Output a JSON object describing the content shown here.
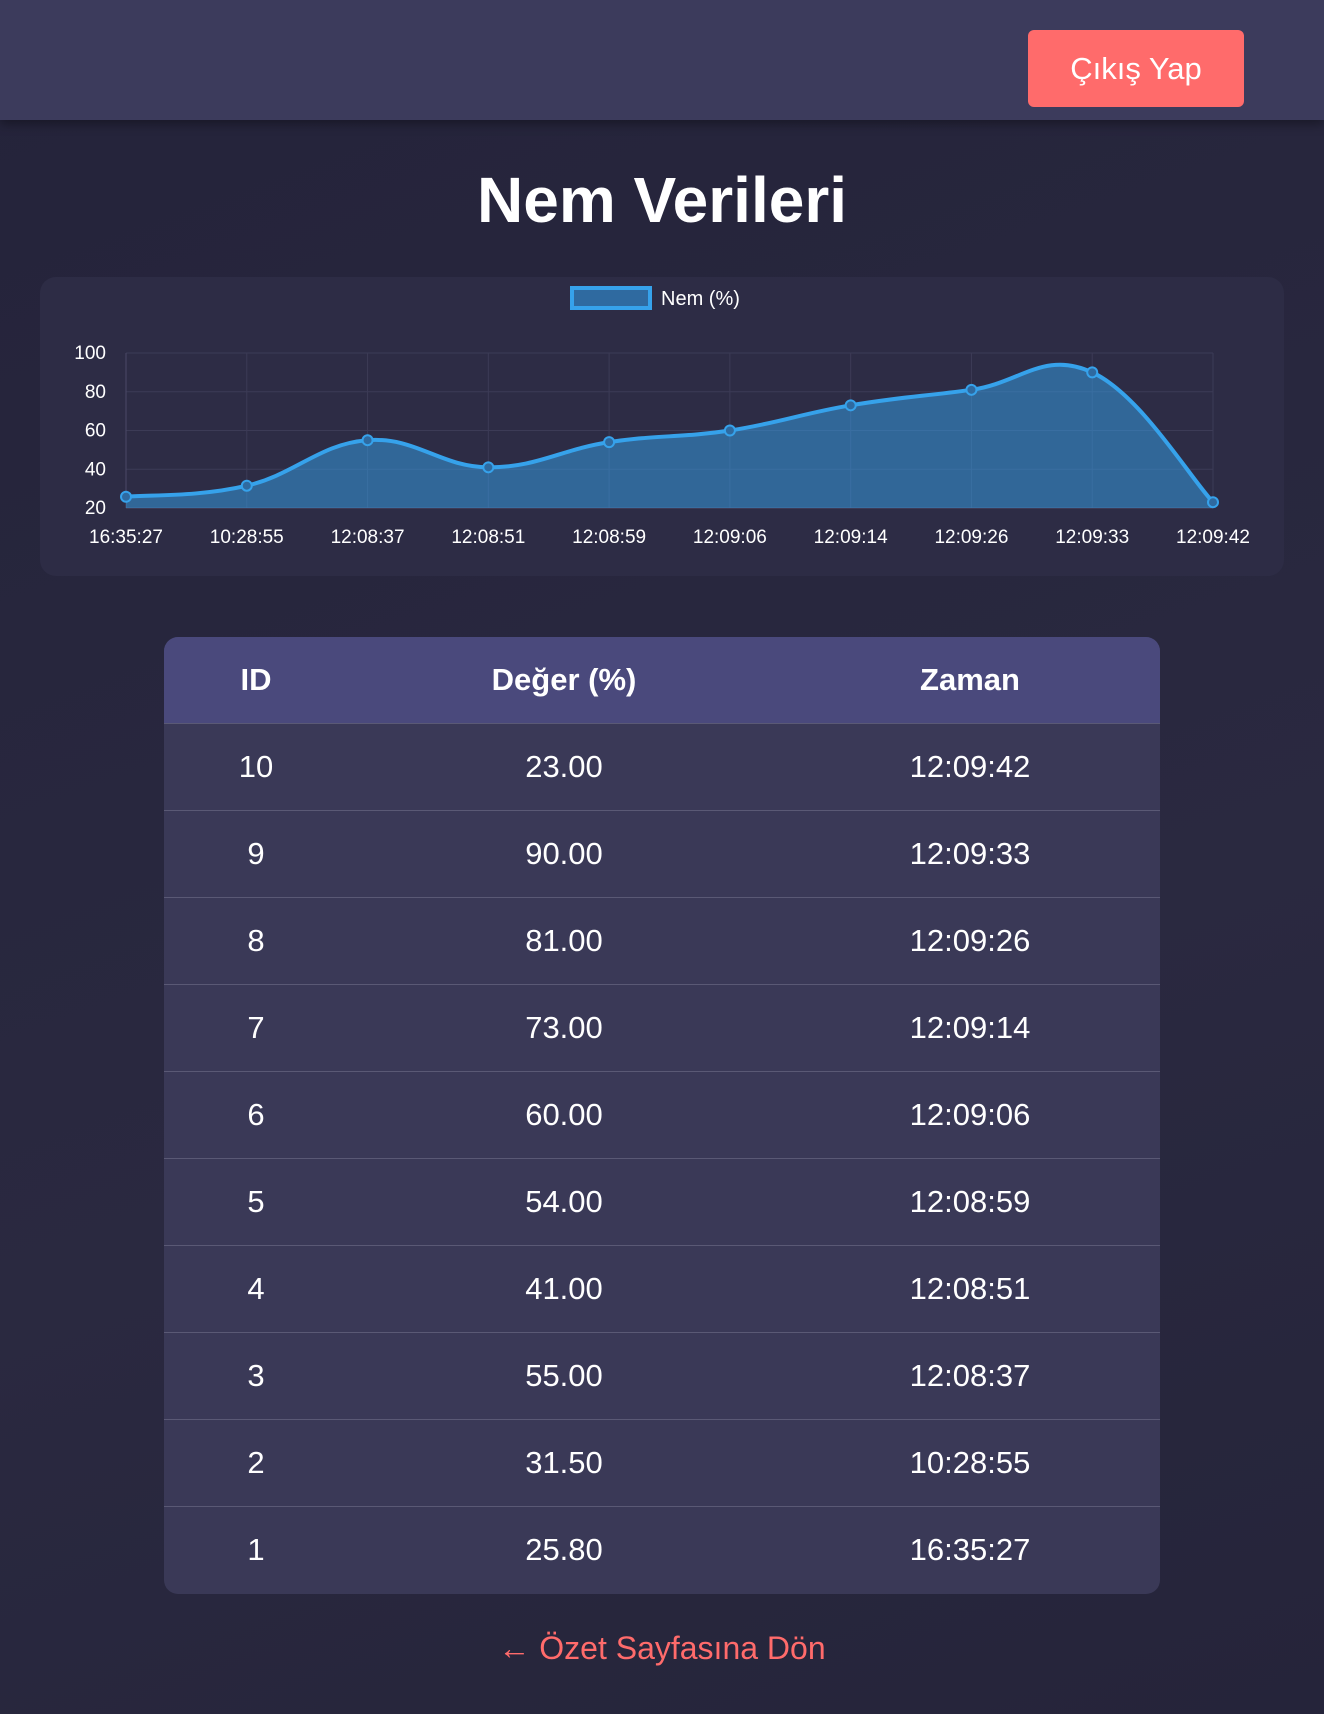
{
  "header": {
    "logout_label": "Çıkış Yap"
  },
  "page": {
    "title": "Nem Verileri"
  },
  "colors": {
    "accent": "#ff6b6b",
    "series": "#36a2eb",
    "header_bg": "#3c3b5c",
    "table_header_bg": "#4a497c"
  },
  "chart_data": {
    "type": "area",
    "title": "",
    "xlabel": "",
    "ylabel": "",
    "categories": [
      "16:35:27",
      "10:28:55",
      "12:08:37",
      "12:08:51",
      "12:08:59",
      "12:09:06",
      "12:09:14",
      "12:09:26",
      "12:09:33",
      "12:09:42"
    ],
    "series": [
      {
        "name": "Nem (%)",
        "values": [
          25.8,
          31.5,
          55,
          41,
          54,
          60,
          73,
          81,
          90,
          23
        ]
      }
    ],
    "ylim": [
      20,
      100
    ],
    "yticks": [
      20,
      40,
      60,
      80,
      100
    ],
    "grid": true,
    "legend": "top-center"
  },
  "table": {
    "headers": [
      "ID",
      "Değer (%)",
      "Zaman"
    ],
    "rows": [
      [
        "10",
        "23.00",
        "12:09:42"
      ],
      [
        "9",
        "90.00",
        "12:09:33"
      ],
      [
        "8",
        "81.00",
        "12:09:26"
      ],
      [
        "7",
        "73.00",
        "12:09:14"
      ],
      [
        "6",
        "60.00",
        "12:09:06"
      ],
      [
        "5",
        "54.00",
        "12:08:59"
      ],
      [
        "4",
        "41.00",
        "12:08:51"
      ],
      [
        "3",
        "55.00",
        "12:08:37"
      ],
      [
        "2",
        "31.50",
        "10:28:55"
      ],
      [
        "1",
        "25.80",
        "16:35:27"
      ]
    ]
  },
  "footer": {
    "back_link": "← Özet Sayfasına Dön"
  }
}
